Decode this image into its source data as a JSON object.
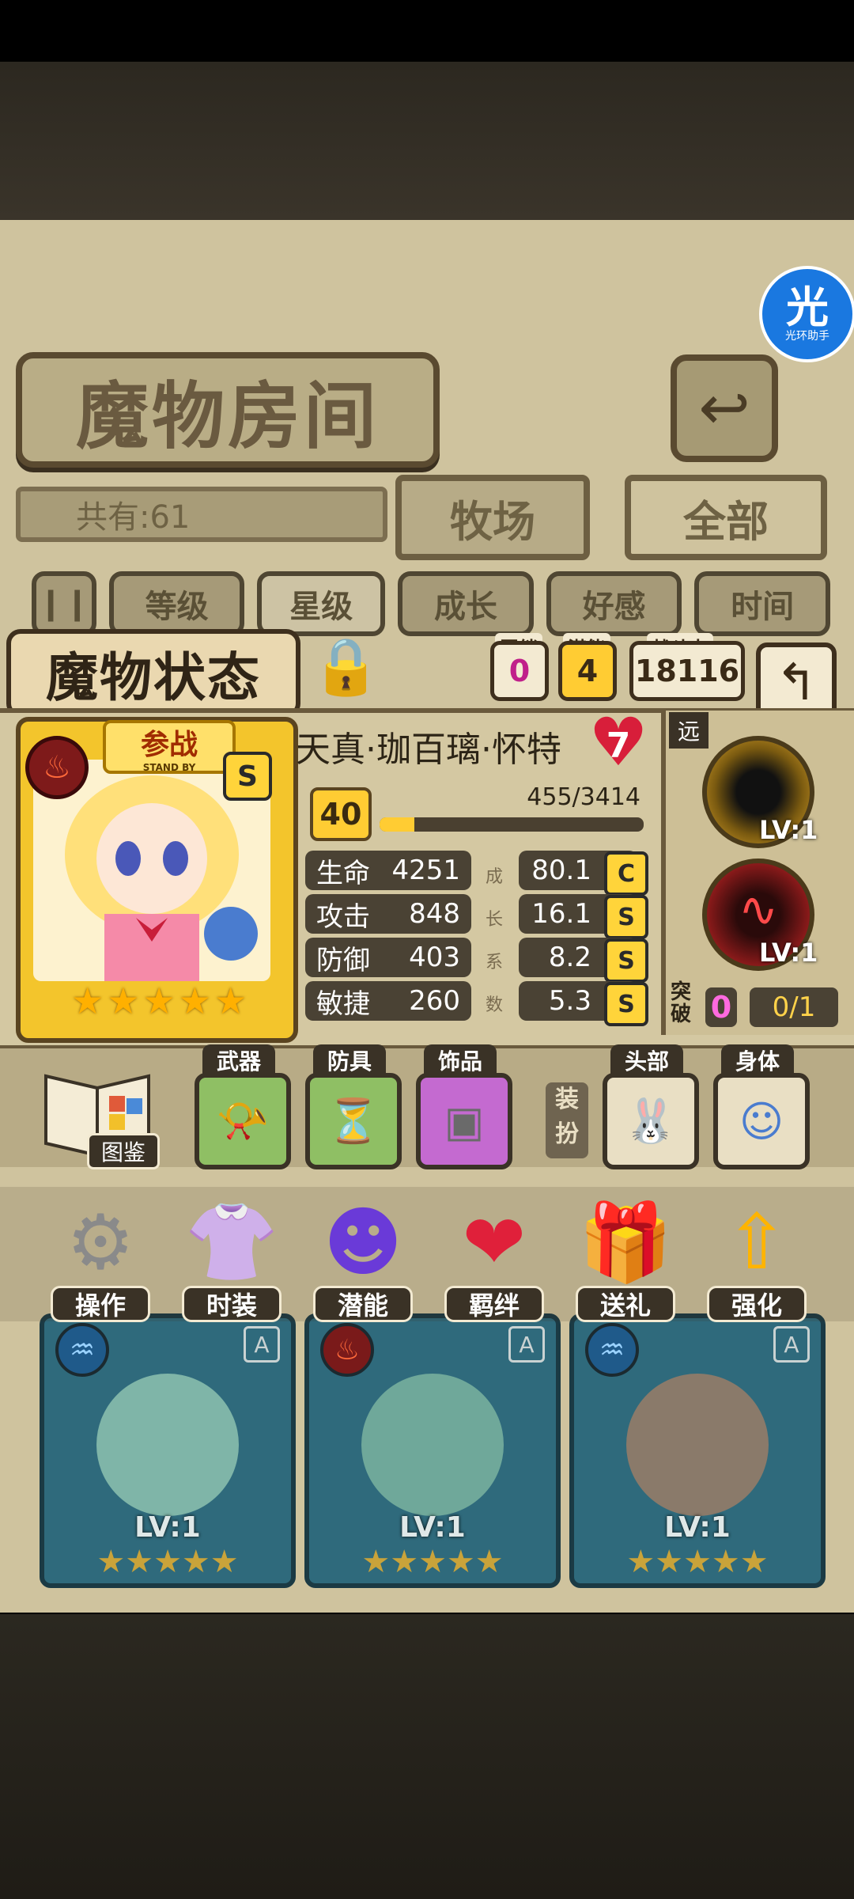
{
  "room": {
    "title": "魔物房间",
    "count": "共有:61",
    "tab_farm": "牧场",
    "tab_all": "全部",
    "sort_buttons": [
      "等级",
      "星级",
      "成长",
      "好感",
      "时间"
    ]
  },
  "halo": {
    "glyph": "光",
    "label": "光环助手"
  },
  "status": {
    "title": "魔物状态",
    "bond_label": "羁绊",
    "bond_value": "0",
    "potential_label": "潜能",
    "potential_value": "4",
    "power_label": "战斗力",
    "power_value": "18116"
  },
  "monster": {
    "standby_label": "参战",
    "standby_sub": "STAND BY",
    "rank": "S",
    "stars": 5,
    "name": "天真·珈百璃·怀特",
    "affection": "7",
    "level": "40",
    "exp_text": "455/3414",
    "exp_fraction": 0.133,
    "stats": [
      {
        "label": "生命",
        "value": "4251",
        "growth": "80.1",
        "grade": "C"
      },
      {
        "label": "攻击",
        "value": "848",
        "growth": "16.1",
        "grade": "S"
      },
      {
        "label": "防御",
        "value": "403",
        "growth": "8.2",
        "grade": "S"
      },
      {
        "label": "敏捷",
        "value": "260",
        "growth": "5.3",
        "grade": "S"
      }
    ],
    "growth_vertical": [
      "成",
      "长",
      "系",
      "数"
    ],
    "range": "远",
    "skill1_level": "LV:1",
    "skill2_level": "LV:1",
    "break_label": "突破",
    "break_value": "0",
    "break_progress": "0/1"
  },
  "equipment": {
    "book_label": "图鉴",
    "weapon_label": "武器",
    "armor_label": "防具",
    "accessory_label": "饰品",
    "dress_label": "装扮",
    "head_label": "头部",
    "body_label": "身体"
  },
  "menu": [
    "操作",
    "时装",
    "潜能",
    "羁绊",
    "送礼",
    "强化"
  ],
  "roster": [
    {
      "level": "LV:1",
      "grade": "A",
      "element": "water"
    },
    {
      "level": "LV:1",
      "grade": "A",
      "element": "fire"
    },
    {
      "level": "LV:1",
      "grade": "A",
      "element": "water"
    }
  ],
  "colors": {
    "accent_gold": "#ffcc33",
    "parchment": "#d4c8a2",
    "heart": "#d81e3a",
    "bond_pink": "#ff6adf"
  }
}
